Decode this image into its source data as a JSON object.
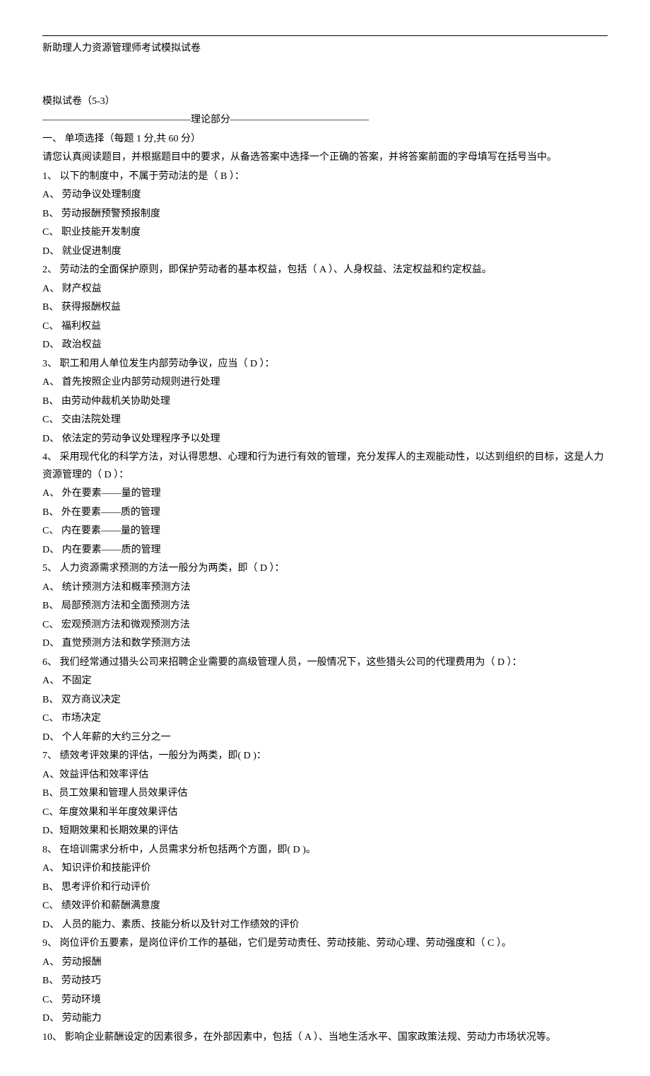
{
  "document_title": "新助理人力资源管理师考试模拟试卷",
  "subtitle": "模拟试卷（5-3）",
  "section_divider": "―――――――――――――――理论部分――――――――――――――",
  "section_heading": "一、 单项选择（每题 1 分,共 60 分）",
  "instruction": "请您认真阅读题目，并根据题目中的要求，从备选答案中选择一个正确的答案，并将答案前面的字母填写在括号当中。",
  "questions": [
    {
      "num": "1、",
      "text": "以下的制度中，不属于劳动法的是（ B ）：",
      "options": [
        "A、 劳动争议处理制度",
        "B、 劳动报酬预警预报制度",
        "C、 职业技能开发制度",
        "D、 就业促进制度"
      ]
    },
    {
      "num": "2、",
      "text": "劳动法的全面保护原则，即保护劳动者的基本权益，包括（ A ）、人身权益、法定权益和约定权益。",
      "options": [
        "A、 财产权益",
        "B、 获得报酬权益",
        "C、 福利权益",
        "D、 政治权益"
      ]
    },
    {
      "num": "3、",
      "text": "职工和用人单位发生内部劳动争议，应当（ D ）：",
      "options": [
        "A、 首先按照企业内部劳动规则进行处理",
        "B、 由劳动仲裁机关协助处理",
        "C、 交由法院处理",
        "D、 依法定的劳动争议处理程序予以处理"
      ]
    },
    {
      "num": "4、",
      "text": "采用现代化的科学方法，对认得思想、心理和行为进行有效的管理，充分发挥人的主观能动性，以达到组织的目标，这是人力资源管理的（ D ）：",
      "options": [
        "A、 外在要素——量的管理",
        "B、 外在要素——质的管理",
        "C、 内在要素——量的管理",
        "D、 内在要素——质的管理"
      ]
    },
    {
      "num": "5、",
      "text": "人力资源需求预测的方法一般分为两类，即（ D ）：",
      "options": [
        "A、 统计预测方法和概率预测方法",
        "B、 局部预测方法和全面预测方法",
        "C、 宏观预测方法和微观预测方法",
        "D、 直觉预测方法和数学预测方法"
      ]
    },
    {
      "num": "6、",
      "text": "我们经常通过猎头公司来招聘企业需要的高级管理人员，一般情况下，这些猎头公司的代理费用为（ D ）：",
      "options": [
        "A、 不固定",
        "B、 双方商议决定",
        "C、 市场决定",
        "D、 个人年薪的大约三分之一"
      ]
    },
    {
      "num": "7、",
      "text": "绩效考评效果的评估，一般分为两类，即(   D   )：",
      "options": [
        "A、效益评估和效率评估",
        "B、员工效果和管理人员效果评估",
        "C、年度效果和半年度效果评估",
        "D、短期效果和长期效果的评估"
      ]
    },
    {
      "num": "8、",
      "text": "在培训需求分析中，人员需求分析包括两个方面，即( D )。",
      "options": [
        "A、 知识评价和技能评价",
        "B、 思考评价和行动评价",
        "C、 绩效评价和薪酬满意度",
        "D、 人员的能力、素质、技能分析以及针对工作绩效的评价"
      ]
    },
    {
      "num": "9、",
      "text": "岗位评价五要素，是岗位评价工作的基础，它们是劳动责任、劳动技能、劳动心理、劳动强度和（ C ）。",
      "options": [
        "A、 劳动报酬",
        "B、 劳动技巧",
        "C、 劳动环境",
        "D、 劳动能力"
      ]
    },
    {
      "num": "10、",
      "text": "影响企业薪酬设定的因素很多，在外部因素中，包括（ A ）、当地生活水平、国家政策法规、劳动力市场状况等。",
      "options": []
    }
  ]
}
